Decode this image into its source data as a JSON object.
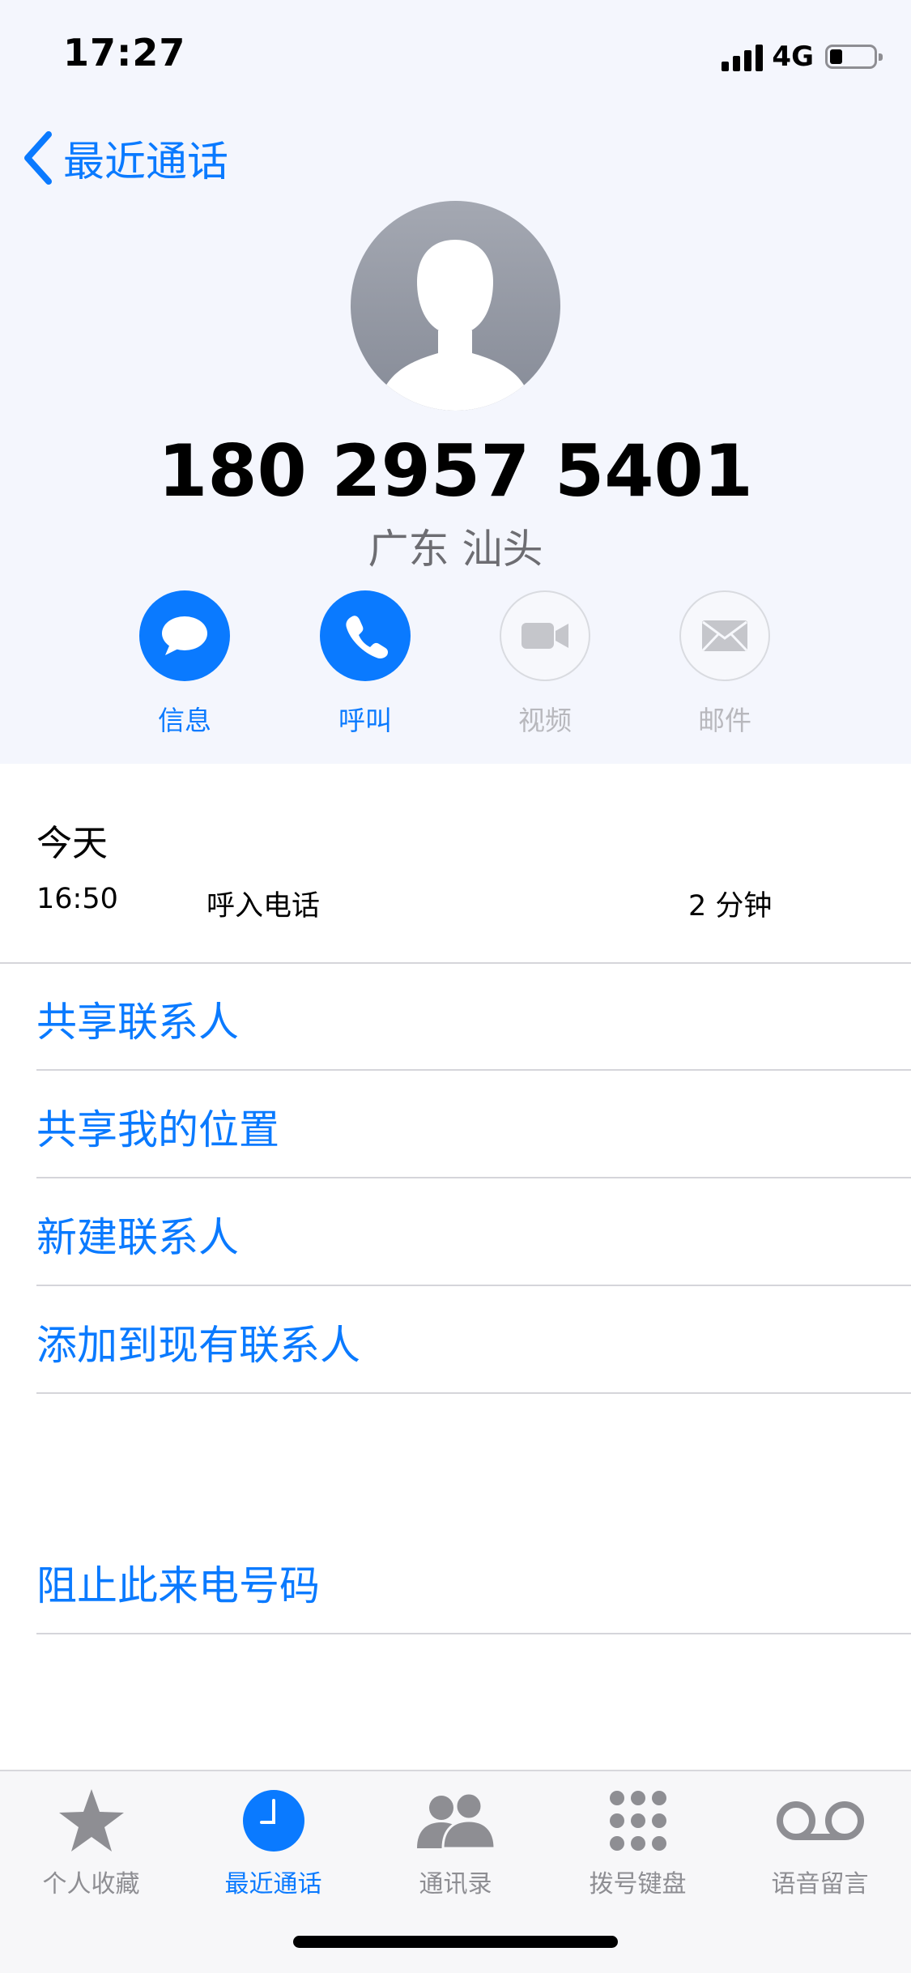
{
  "status_bar": {
    "time": "17:27",
    "network": "4G",
    "battery_level": 0.2
  },
  "nav": {
    "back_label": "最近通话"
  },
  "contact": {
    "phone_number": "180 2957 5401",
    "location": "广东 汕头",
    "avatar_icon": "person-silhouette-icon"
  },
  "actions": [
    {
      "label": "信息",
      "icon": "message-bubble-icon",
      "enabled": true
    },
    {
      "label": "呼叫",
      "icon": "phone-icon",
      "enabled": true
    },
    {
      "label": "视频",
      "icon": "video-camera-icon",
      "enabled": false
    },
    {
      "label": "邮件",
      "icon": "envelope-icon",
      "enabled": false
    }
  ],
  "recent": {
    "day": "今天",
    "calls": [
      {
        "time": "16:50",
        "type": "呼入电话",
        "duration": "2 分钟"
      }
    ]
  },
  "menu": {
    "share_contact": "共享联系人",
    "share_location": "共享我的位置",
    "new_contact": "新建联系人",
    "add_existing": "添加到现有联系人",
    "block_caller": "阻止此来电号码"
  },
  "tabs": [
    {
      "label": "个人收藏",
      "icon": "star-icon",
      "active": false
    },
    {
      "label": "最近通话",
      "icon": "clock-icon",
      "active": true
    },
    {
      "label": "通讯录",
      "icon": "contacts-icon",
      "active": false
    },
    {
      "label": "拨号键盘",
      "icon": "keypad-icon",
      "active": false
    },
    {
      "label": "语音留言",
      "icon": "voicemail-icon",
      "active": false
    }
  ],
  "colors": {
    "accent": "#0a7aff",
    "disabled": "#b8b8bd",
    "header_background": "#f4f6fd",
    "tab_inactive": "#8e8e93"
  }
}
